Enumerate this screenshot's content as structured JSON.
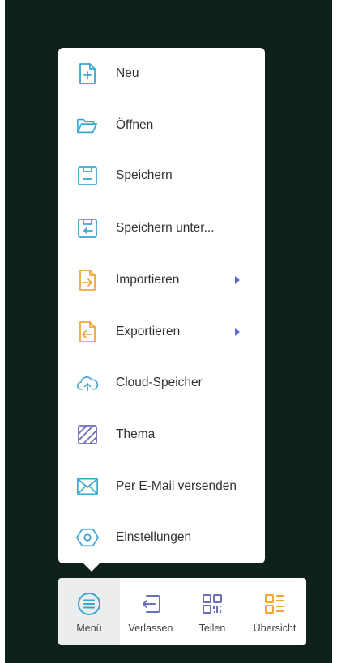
{
  "menu": {
    "items": [
      {
        "id": "new",
        "label": "Neu",
        "icon": "new-file-icon"
      },
      {
        "id": "open",
        "label": "Öffnen",
        "icon": "folder-open-icon"
      },
      {
        "id": "save",
        "label": "Speichern",
        "icon": "save-icon"
      },
      {
        "id": "save-as",
        "label": "Speichern unter...",
        "icon": "save-as-icon"
      },
      {
        "id": "import",
        "label": "Importieren",
        "icon": "import-icon",
        "submenu": true
      },
      {
        "id": "export",
        "label": "Exportieren",
        "icon": "export-icon",
        "submenu": true
      },
      {
        "id": "cloud",
        "label": "Cloud-Speicher",
        "icon": "cloud-upload-icon"
      },
      {
        "id": "theme",
        "label": "Thema",
        "icon": "theme-icon"
      },
      {
        "id": "email",
        "label": "Per E-Mail versenden",
        "icon": "email-icon"
      },
      {
        "id": "settings",
        "label": "Einstellungen",
        "icon": "settings-hexagon-icon"
      }
    ]
  },
  "bottom_bar": {
    "items": [
      {
        "id": "menu",
        "label": "Menü",
        "icon": "menu-icon",
        "active": true
      },
      {
        "id": "leave",
        "label": "Verlassen",
        "icon": "exit-icon",
        "active": false
      },
      {
        "id": "share",
        "label": "Teilen",
        "icon": "qr-code-icon",
        "active": false
      },
      {
        "id": "overview",
        "label": "Übersicht",
        "icon": "overview-list-icon",
        "active": false
      }
    ]
  },
  "colors": {
    "background": "#0f211d",
    "blue_icon": "#3aa6d0",
    "orange_icon": "#f0a63a",
    "purple_icon": "#6a6fb8",
    "submenu_arrow": "#5a6bd4"
  }
}
